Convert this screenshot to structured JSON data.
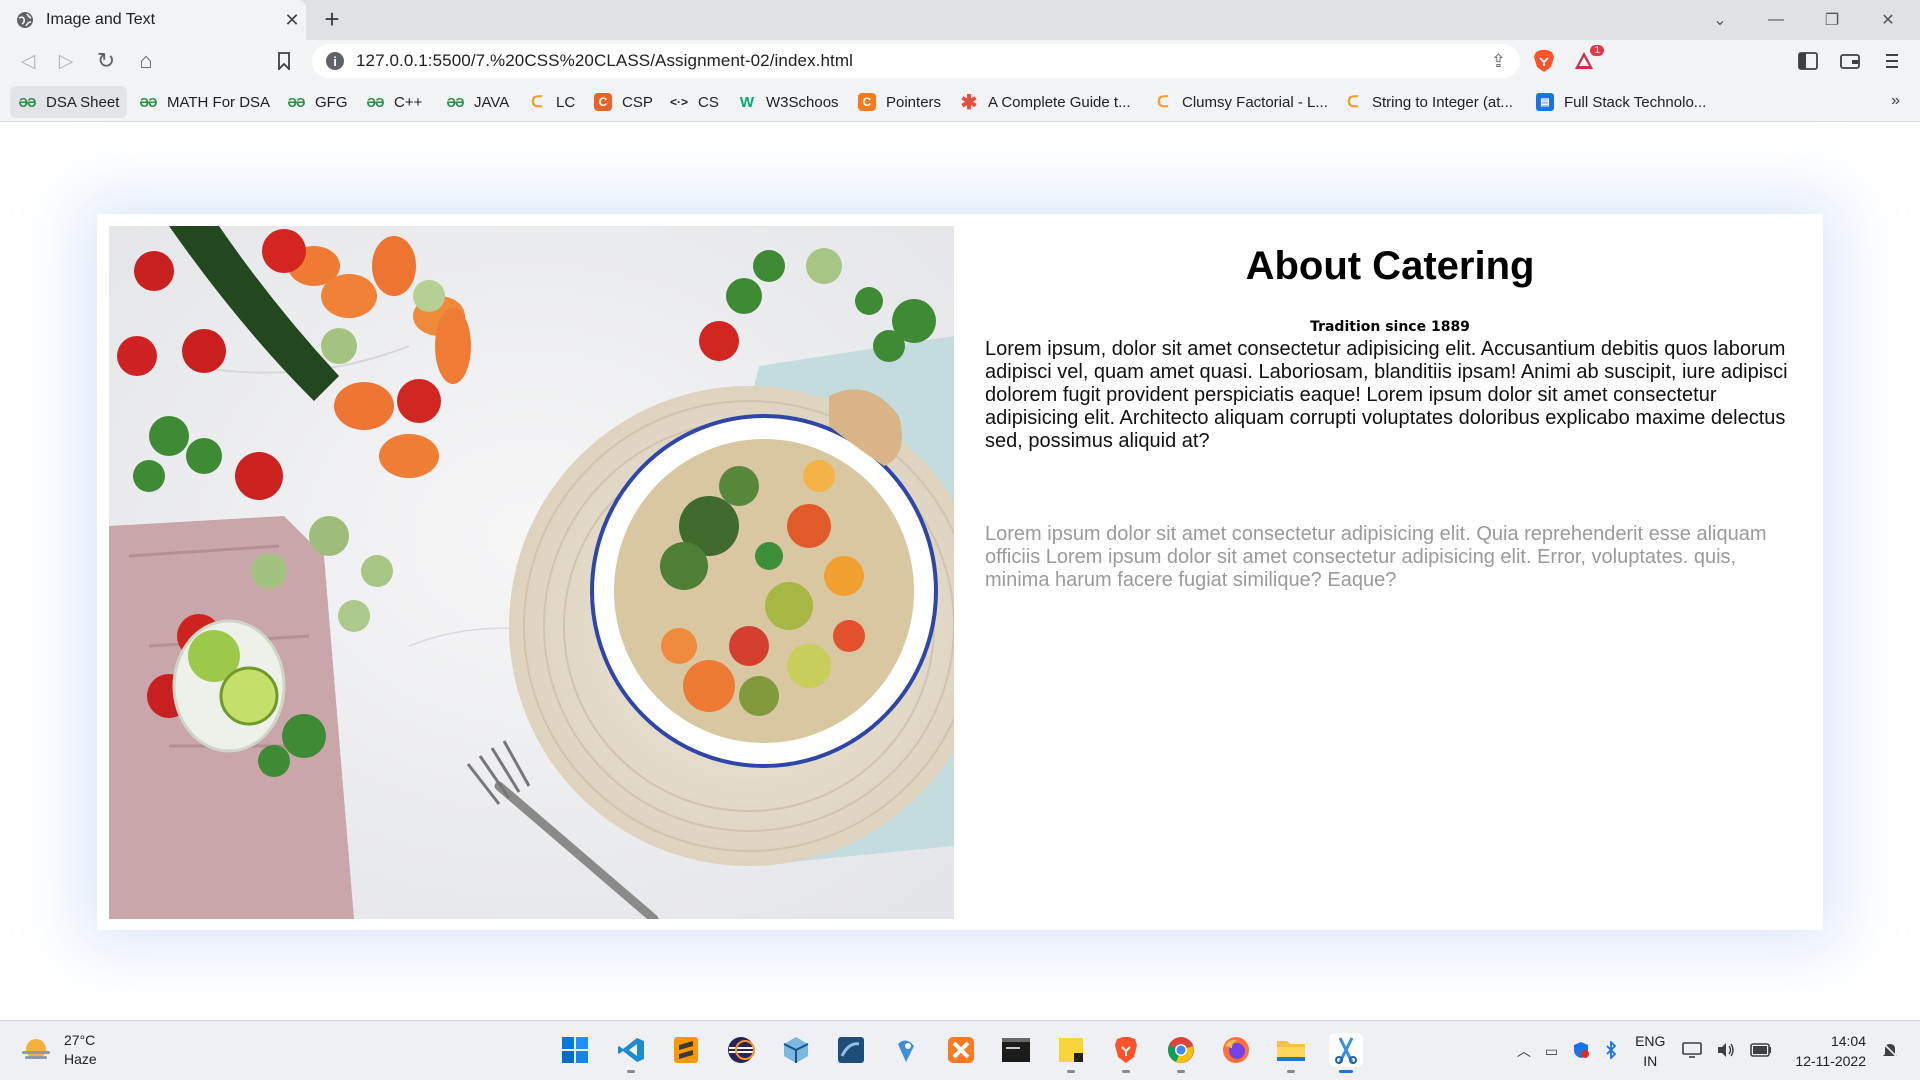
{
  "tab": {
    "title": "Image and Text",
    "close_glyph": "✕",
    "new_tab_glyph": "+"
  },
  "window": {
    "chevron": "⌄",
    "minimize": "—",
    "restore": "❐",
    "close": "✕"
  },
  "toolbar": {
    "back": "◁",
    "forward": "▷",
    "reload": "↻",
    "home": "⌂",
    "bookmark": "🔖",
    "url": "127.0.0.1:5500/7.%20CSS%20CLASS/Assignment-02/index.html",
    "info": "i",
    "share": "⇪",
    "brave_badge": "1"
  },
  "bookmarks": [
    {
      "label": "DSA Sheet",
      "icon": "gfg-icon",
      "glyph": "ƏƏ"
    },
    {
      "label": "MATH For DSA",
      "icon": "gfg-icon",
      "glyph": "ƏƏ"
    },
    {
      "label": "GFG",
      "icon": "gfg-icon",
      "glyph": "ƏƏ"
    },
    {
      "label": "C++",
      "icon": "gfg-icon",
      "glyph": "ƏƏ"
    },
    {
      "label": "JAVA",
      "icon": "gfg-icon",
      "glyph": "ƏƏ"
    },
    {
      "label": "LC",
      "icon": "leetcode-icon",
      "glyph": "ᑕ"
    },
    {
      "label": "CSP",
      "icon": "csp-icon",
      "glyph": "C"
    },
    {
      "label": "CS",
      "icon": "code-icon",
      "glyph": "<·>"
    },
    {
      "label": "W3Schoos",
      "icon": "w3schools-icon",
      "glyph": "W"
    },
    {
      "label": "Pointers",
      "icon": "pointers-icon",
      "glyph": "C"
    },
    {
      "label": "A Complete Guide t...",
      "icon": "asterisk-icon",
      "glyph": "✱"
    },
    {
      "label": "Clumsy Factorial - L...",
      "icon": "leetcode-icon",
      "glyph": "ᑕ"
    },
    {
      "label": "String to Integer (at...",
      "icon": "leetcode-icon",
      "glyph": "ᑕ"
    },
    {
      "label": "Full Stack Technolo...",
      "icon": "document-icon",
      "glyph": "▤"
    }
  ],
  "bookmarks_overflow": "»",
  "page": {
    "title": "About Catering",
    "subtitle": "Tradition since 1889",
    "paragraph1": "Lorem ipsum, dolor sit amet consectetur adipisicing elit. Accusantium debitis quos laborum adipisci vel, quam amet quasi. Laboriosam, blanditiis ipsam! Animi ab suscipit, iure adipisci dolorem fugit provident perspiciatis eaque! Lorem ipsum dolor sit amet consectetur adipisicing elit. Architecto aliquam corrupti voluptates doloribus explicabo maxime delectus sed, possimus aliquid at?",
    "paragraph2": "Lorem ipsum dolor sit amet consectetur adipisicing elit. Quia reprehenderit esse aliquam officiis Lorem ipsum dolor sit amet consectetur adipisicing elit. Error, voluptates. quis, minima harum facere fugiat similique? Eaque?"
  },
  "taskbar": {
    "weather": {
      "temp": "27°C",
      "condition": "Haze"
    },
    "apps": [
      "windows-start",
      "vscode",
      "sublime-text",
      "eclipse",
      "virtualbox",
      "mysql-workbench",
      "android-studio",
      "xampp",
      "mysql-terminal",
      "sticky-notes",
      "brave",
      "chrome",
      "firefox",
      "file-explorer",
      "snipping-tool"
    ],
    "lang": {
      "line1": "ENG",
      "line2": "IN"
    },
    "clock": {
      "time": "14:04",
      "date": "12-11-2022"
    }
  },
  "colors": {
    "accent": "#1a73e8",
    "gfg_green": "#2f8d46",
    "brave_orange": "#fb542b"
  }
}
